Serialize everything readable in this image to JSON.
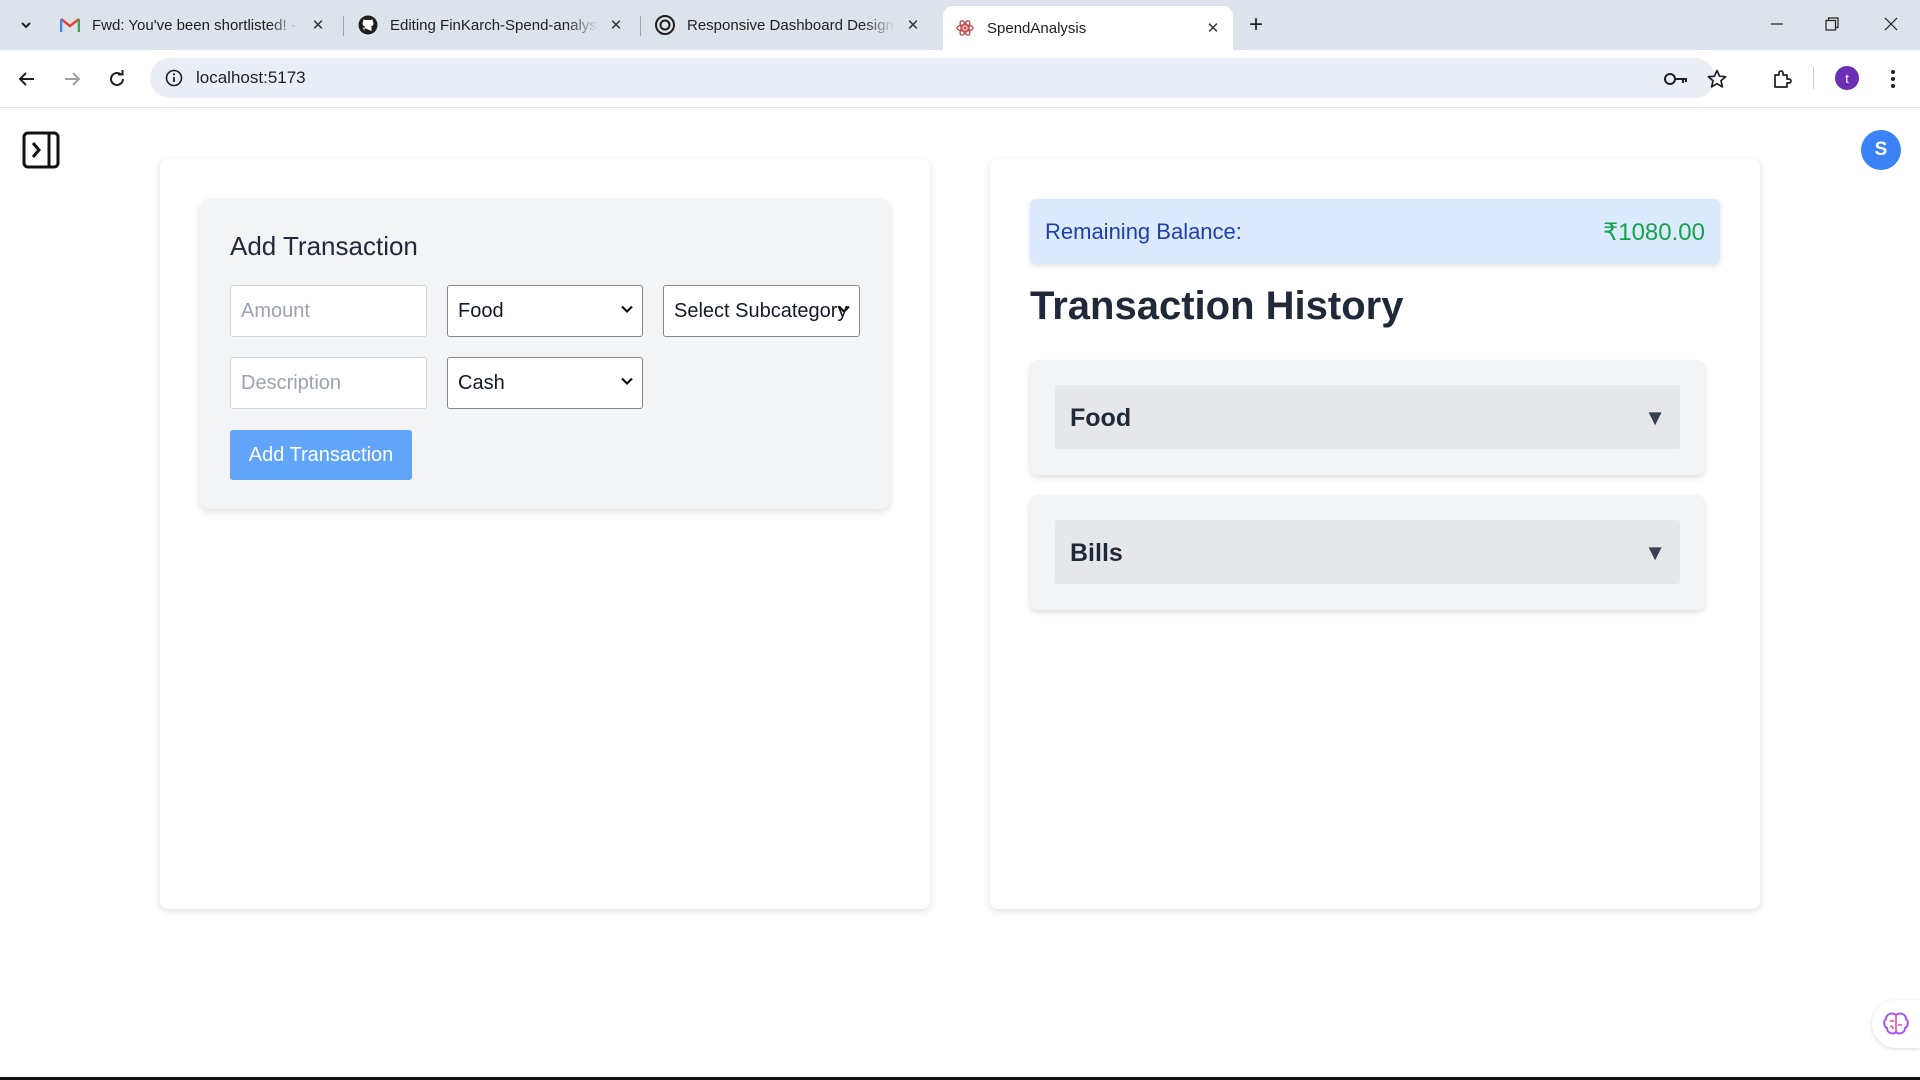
{
  "browser": {
    "tabs": [
      {
        "title": "Fwd: You've been shortlisted! - t",
        "icon": "gmail-icon",
        "active": false
      },
      {
        "title": "Editing FinKarch-Spend-analysis",
        "icon": "github-icon",
        "active": false
      },
      {
        "title": "Responsive Dashboard Design",
        "icon": "openai-icon",
        "active": false
      },
      {
        "title": "SpendAnalysis",
        "icon": "react-icon",
        "active": true
      }
    ],
    "url": "localhost:5173",
    "profile_initial": "t"
  },
  "app": {
    "user_initial": "S",
    "form": {
      "title": "Add Transaction",
      "amount_placeholder": "Amount",
      "category_selected": "Food",
      "subcategory_selected": "Select Subcategory",
      "description_placeholder": "Description",
      "payment_selected": "Cash",
      "submit_label": "Add Transaction"
    },
    "balance": {
      "label": "Remaining Balance:",
      "value": "₹1080.00"
    },
    "history": {
      "title": "Transaction History",
      "categories": [
        {
          "name": "Food",
          "arrow": "▼"
        },
        {
          "name": "Bills",
          "arrow": "▼"
        }
      ]
    }
  },
  "colors": {
    "accent_button": "#60a5fa",
    "balance_bg": "#dbeafe",
    "balance_value": "#16a34a",
    "avatar": "#3b82f6"
  }
}
